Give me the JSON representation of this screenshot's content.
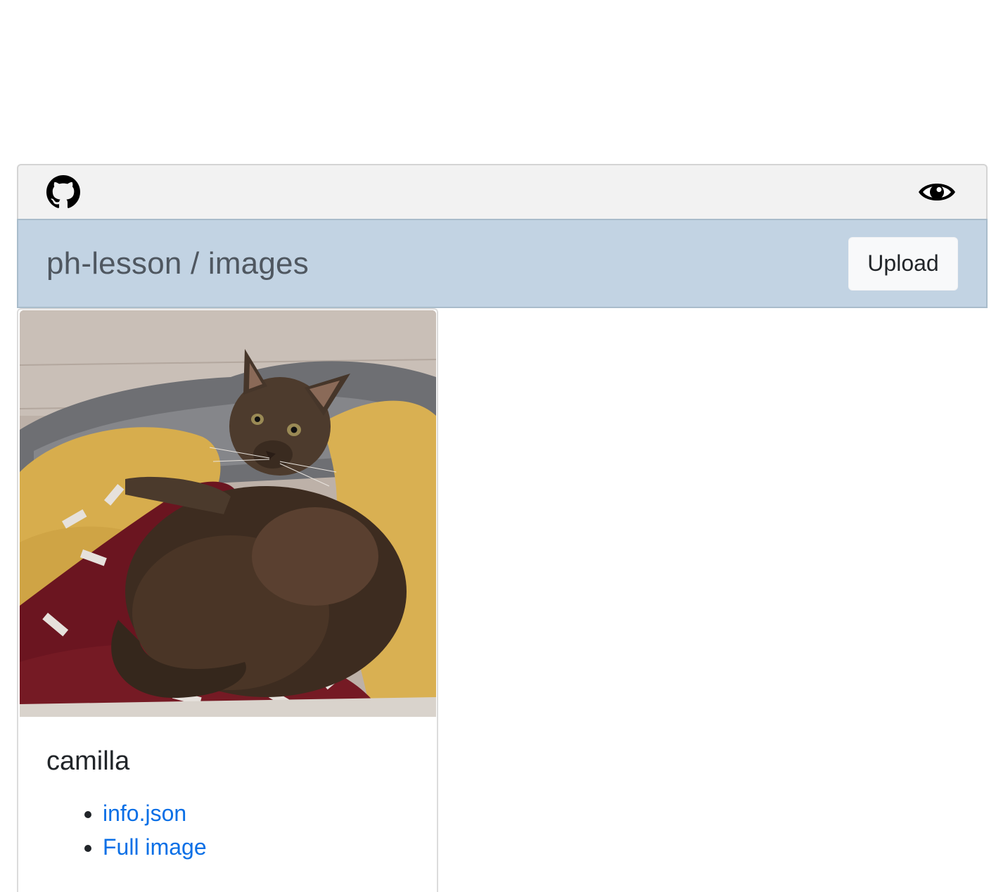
{
  "header": {
    "github_icon": "github-icon",
    "watch_icon": "eye-icon",
    "repo_path": "ph-lesson / images",
    "upload_label": "Upload"
  },
  "cards": [
    {
      "title": "camilla",
      "image_alt": "cat",
      "links": [
        {
          "label": "info.json"
        },
        {
          "label": "Full image"
        }
      ]
    }
  ],
  "colors": {
    "topbar_bg": "#f2f2f2",
    "header_bg": "#c2d3e3",
    "link": "#0a6fe6",
    "title_text": "#4f5760"
  }
}
